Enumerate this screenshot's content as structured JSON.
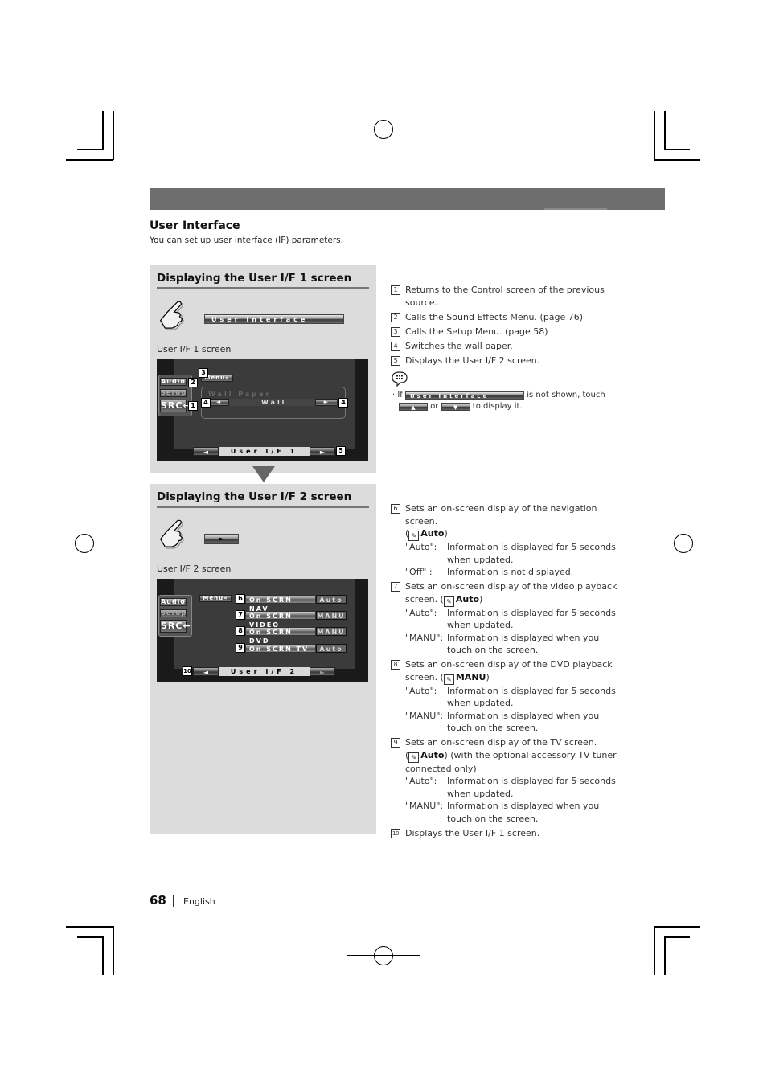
{
  "section": {
    "title": "User Interface",
    "subtitle": "You can set up user interface (IF) parameters."
  },
  "panel1": {
    "title": "Displaying the User I/F 1 screen",
    "button_label": "User  Interface",
    "caption": "User I/F 1 screen",
    "screen": {
      "audio": "Audio",
      "setup": "SetUp",
      "src": "SRC←",
      "menu": "Menu«",
      "wall_paper_label": "Wall Paper",
      "wall_value": "Wall",
      "left_arrow": "◄",
      "right_arrow": "►",
      "page_label": "User  I/F  1",
      "callouts": [
        "1",
        "2",
        "3",
        "4",
        "4",
        "5"
      ]
    }
  },
  "panel2": {
    "title": "Displaying the User I/F 2 screen",
    "button_label": "►",
    "caption": "User I/F 2 screen",
    "screen": {
      "audio": "Audio",
      "setup": "SetUp",
      "src": "SRC←",
      "menu": "Menu«",
      "rows": [
        {
          "callout": "6",
          "label": "On  SCRN  NAV",
          "value": "Auto"
        },
        {
          "callout": "7",
          "label": "On  SCRN  VIDEO",
          "value": "MANU"
        },
        {
          "callout": "8",
          "label": "On  SCRN  DVD",
          "value": "MANU"
        },
        {
          "callout": "9",
          "label": "On  SCRN  TV",
          "value": "Auto"
        }
      ],
      "left_arrow": "◄",
      "right_arrow": "►",
      "page_label": "User  I/F  2",
      "callout_nav": "10"
    }
  },
  "list1": [
    {
      "num": "1",
      "text": "Returns to the Control screen of the previous source."
    },
    {
      "num": "2",
      "text": "Calls the Sound Effects Menu. (page 76)"
    },
    {
      "num": "3",
      "text": "Calls the Setup Menu. (page 58)"
    },
    {
      "num": "4",
      "text": "Switches the wall paper."
    },
    {
      "num": "5",
      "text": "Displays the User I/F 2 screen."
    }
  ],
  "note": {
    "prefix": "If",
    "button": "User  Interface",
    "middle": "is not shown, touch",
    "up": "▲",
    "or": "or",
    "down": "▼",
    "suffix": "to display it."
  },
  "list2": [
    {
      "num": "6",
      "text": "Sets an on-screen display of the navigation screen.",
      "default_prefix": "(",
      "default": "Auto",
      "default_suffix": ")",
      "defs": [
        {
          "k": "\"Auto\":",
          "v": "Information is displayed for 5 seconds when updated."
        },
        {
          "k": "\"Off\" :",
          "v": "Information is not displayed."
        }
      ]
    },
    {
      "num": "7",
      "text": "Sets an on-screen display of the video playback screen. (",
      "default": "Auto",
      "default_suffix": ")",
      "defs": [
        {
          "k": "\"Auto\":",
          "v": "Information is displayed for 5 seconds when updated."
        },
        {
          "k": "\"MANU\":",
          "v": "Information is displayed when you touch on the screen."
        }
      ]
    },
    {
      "num": "8",
      "text": "Sets an on-screen display of the DVD playback screen. (",
      "default": "MANU",
      "default_suffix": ")",
      "defs": [
        {
          "k": "\"Auto\":",
          "v": "Information is displayed for 5 seconds when updated."
        },
        {
          "k": "\"MANU\":",
          "v": "Information is displayed when you touch on the screen."
        }
      ]
    },
    {
      "num": "9",
      "text": "Sets an on-screen display of the TV screen.",
      "default_prefix": "(",
      "default": "Auto",
      "default_suffix": ") (with the optional accessory TV tuner connected only)",
      "defs": [
        {
          "k": "\"Auto\":",
          "v": "Information is displayed for 5 seconds when updated."
        },
        {
          "k": "\"MANU\":",
          "v": "Information is displayed when you touch on the screen."
        }
      ]
    },
    {
      "num": "10",
      "text": "Displays the User I/F 1 screen."
    }
  ],
  "footer": {
    "page_number": "68",
    "language": "English"
  }
}
